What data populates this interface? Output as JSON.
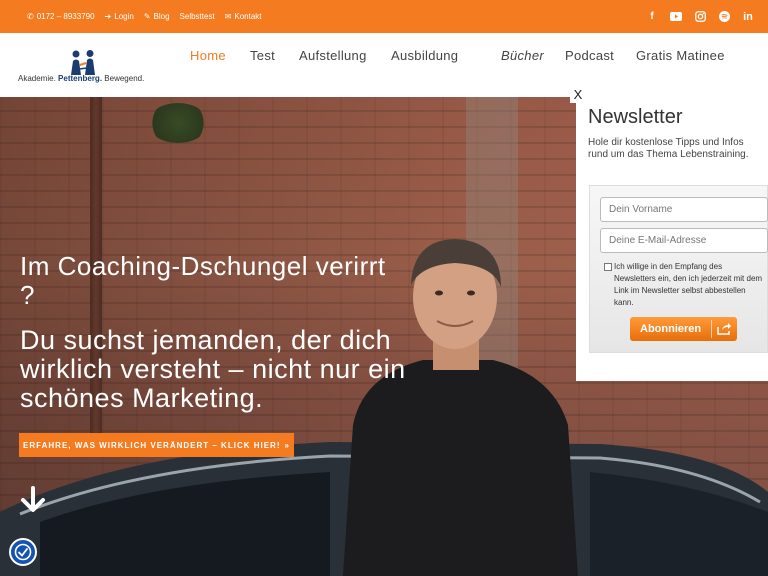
{
  "topbar": {
    "phone": "0172 – 8933790",
    "login": "Login",
    "blog": "Blog",
    "selbsttest": "Selbsttest",
    "kontakt": "Kontakt",
    "social": [
      "facebook-icon",
      "youtube-icon",
      "instagram-icon",
      "spotify-icon",
      "linkedin-icon"
    ]
  },
  "logo": {
    "tag_prefix": "Akademie.",
    "tag_brand": "Pettenberg.",
    "tag_suffix": "Bewegend."
  },
  "nav": {
    "items": [
      {
        "label": "Home",
        "active": true
      },
      {
        "label": "Test"
      },
      {
        "label": "Aufstellung"
      },
      {
        "label": "Ausbildung"
      },
      {
        "label": "Bücher"
      },
      {
        "label": "Podcast"
      },
      {
        "label": "Gratis Matinee"
      }
    ]
  },
  "hero": {
    "headline": "Im Coaching-Dschungel verirrt ?",
    "subheadline": "Du suchst jemanden, der dich wirklich versteht – nicht nur ein schönes Marketing.",
    "cta": "ERFAHRE, WAS WIRKLICH VERÄNDERT – KLICK HIER!"
  },
  "newsletter": {
    "close": "X",
    "title": "Newsletter",
    "description": "Hole dir kostenlose Tipps und Infos rund um das Thema Lebenstraining.",
    "firstname_placeholder": "Dein Vorname",
    "email_placeholder": "Deine E-Mail-Adresse",
    "consent": "Ich willige in den Empfang des Newsletters ein, den ich jederzeit mit dem Link im Newsletter selbst abbestellen kann.",
    "subscribe": "Abonnieren"
  },
  "colors": {
    "accent": "#f47b20",
    "brand_blue": "#1b3d6d",
    "a11y_blue": "#1653b0"
  }
}
